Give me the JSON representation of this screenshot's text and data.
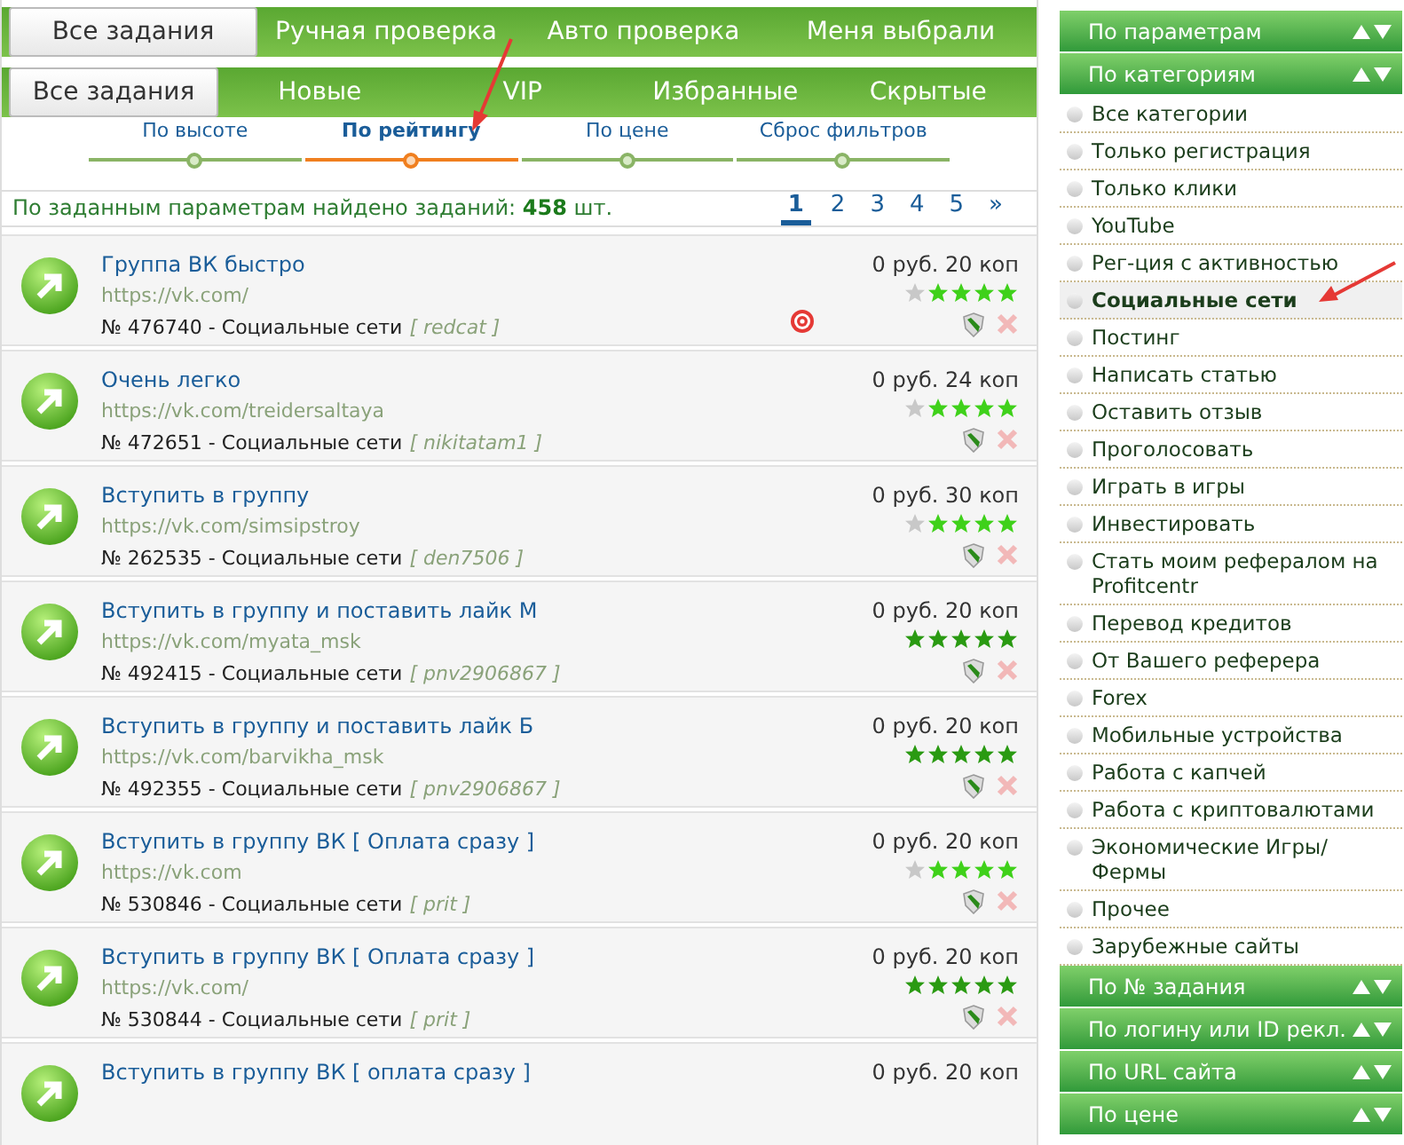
{
  "top_tabs": [
    {
      "label": "Все задания",
      "selected": true
    },
    {
      "label": "Ручная проверка",
      "selected": false
    },
    {
      "label": "Авто проверка",
      "selected": false
    },
    {
      "label": "Меня выбрали",
      "selected": false
    }
  ],
  "sub_tabs": [
    {
      "label": "Все задания",
      "selected": true
    },
    {
      "label": "Новые",
      "selected": false
    },
    {
      "label": "VIP",
      "selected": false
    },
    {
      "label": "Избранные",
      "selected": false
    },
    {
      "label": "Скрытые",
      "selected": false
    }
  ],
  "sort_options": [
    {
      "label": "По высоте",
      "selected": false
    },
    {
      "label": "По рейтингу",
      "selected": true
    },
    {
      "label": "По цене",
      "selected": false
    },
    {
      "label": "Сброс фильтров",
      "selected": false
    }
  ],
  "summary": "По заданным параметрам найдено заданий: **458** шт.",
  "pagination": [
    {
      "label": "1",
      "selected": true
    },
    {
      "label": "2",
      "selected": false
    },
    {
      "label": "3",
      "selected": false
    },
    {
      "label": "4",
      "selected": false
    },
    {
      "label": "5",
      "selected": false
    },
    {
      "label": "»",
      "selected": false
    }
  ],
  "tasks": [
    {
      "title": "Группа ВК быстро",
      "url": "https://vk.com/",
      "meta": "№ 476740 - Социальные сети",
      "author": "[ redcat ]",
      "price": "0 руб. 20 коп",
      "stars": 4,
      "targeted": true
    },
    {
      "title": "Очень легко",
      "url": "https://vk.com/treidersaltaya",
      "meta": "№ 472651 - Социальные сети",
      "author": "[ nikitatam1 ]",
      "price": "0 руб. 24 коп",
      "stars": 4,
      "targeted": false
    },
    {
      "title": "Вступить в группу",
      "url": "https://vk.com/simsipstroy",
      "meta": "№ 262535 - Социальные сети",
      "author": "[ den7506 ]",
      "price": "0 руб. 30 коп",
      "stars": 4,
      "targeted": false
    },
    {
      "title": "Вступить в группу и поставить лайк М",
      "url": "https://vk.com/myata_msk",
      "meta": "№ 492415 - Социальные сети",
      "author": "[ pnv2906867 ]",
      "price": "0 руб. 20 коп",
      "stars": 5,
      "targeted": false
    },
    {
      "title": "Вступить в группу и поставить лайк Б",
      "url": "https://vk.com/barvikha_msk",
      "meta": "№ 492355 - Социальные сети",
      "author": "[ pnv2906867 ]",
      "price": "0 руб. 20 коп",
      "stars": 5,
      "targeted": false
    },
    {
      "title": "Вступить в группу ВК [ Оплата сразу ]",
      "url": "https://vk.com",
      "meta": "№ 530846 - Социальные сети",
      "author": "[ prit ]",
      "price": "0 руб. 20 коп",
      "stars": 4,
      "targeted": false
    },
    {
      "title": "Вступить в группу ВК [ Оплата сразу ]",
      "url": "https://vk.com/",
      "meta": "№ 530844 - Социальные сети",
      "author": "[ prit ]",
      "price": "0 руб. 20 коп",
      "stars": 5,
      "targeted": false
    },
    {
      "title": "Вступить в группу ВК [ оплата сразу ]",
      "price": "0 руб. 20 коп"
    }
  ],
  "sidebar": {
    "sections_top": [
      {
        "label": "По параметрам"
      },
      {
        "label": "По категориям"
      }
    ],
    "categories": [
      {
        "label": "Все категории",
        "selected": false
      },
      {
        "label": "Только регистрация",
        "selected": false
      },
      {
        "label": "Только клики",
        "selected": false
      },
      {
        "label": "YouTube",
        "selected": false
      },
      {
        "label": "Рег-ция с активностью",
        "selected": false
      },
      {
        "label": "Социальные сети",
        "selected": true
      },
      {
        "label": "Постинг",
        "selected": false
      },
      {
        "label": "Написать статью",
        "selected": false
      },
      {
        "label": "Оставить отзыв",
        "selected": false
      },
      {
        "label": "Проголосовать",
        "selected": false
      },
      {
        "label": "Играть в игры",
        "selected": false
      },
      {
        "label": "Инвестировать",
        "selected": false
      },
      {
        "label": "Стать моим рефералом на Profitcentr",
        "selected": false
      },
      {
        "label": "Перевод кредитов",
        "selected": false
      },
      {
        "label": "От Вашего реферера",
        "selected": false
      },
      {
        "label": "Forex",
        "selected": false
      },
      {
        "label": "Мобильные устройства",
        "selected": false
      },
      {
        "label": "Работа с капчей",
        "selected": false
      },
      {
        "label": "Работа с криптовалютами",
        "selected": false
      },
      {
        "label": "Экономические Игры/Фермы",
        "selected": false
      },
      {
        "label": "Прочее",
        "selected": false
      },
      {
        "label": "Зарубежные сайты",
        "selected": false
      }
    ],
    "sections_bottom": [
      {
        "label": "По № задания"
      },
      {
        "label": "По логину или ID рекл."
      },
      {
        "label": "По URL сайта"
      },
      {
        "label": "По цене"
      }
    ]
  }
}
